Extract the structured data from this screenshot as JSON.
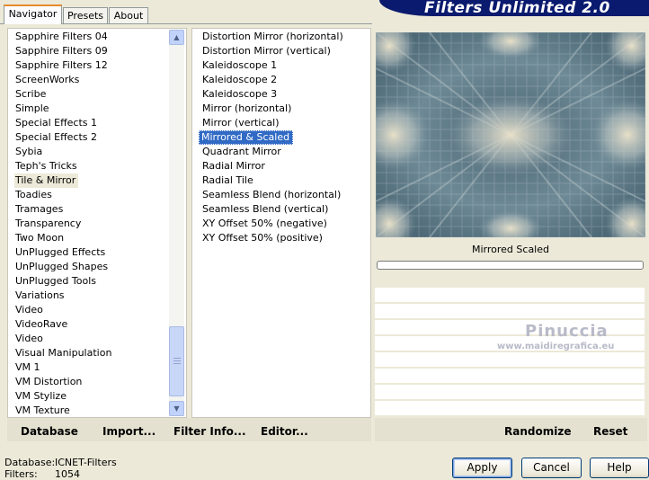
{
  "tabs": [
    "Navigator",
    "Presets",
    "About"
  ],
  "banner_title": "Filters Unlimited 2.0",
  "categories": [
    "Sapphire Filters 04",
    "Sapphire Filters 09",
    "Sapphire Filters 12",
    "ScreenWorks",
    "Scribe",
    "Simple",
    "Special Effects 1",
    "Special Effects 2",
    "Sybia",
    "Teph's Tricks",
    "Tile & Mirror",
    "Toadies",
    "Tramages",
    "Transparency",
    "Two Moon",
    "UnPlugged Effects",
    "UnPlugged Shapes",
    "UnPlugged Tools",
    "Variations",
    "Video",
    "VideoRave",
    "Video",
    "Visual Manipulation",
    "VM 1",
    "VM Distortion",
    "VM Stylize",
    "VM Texture"
  ],
  "selected_category": "Tile & Mirror",
  "filters": [
    "Distortion Mirror (horizontal)",
    "Distortion Mirror (vertical)",
    "Kaleidoscope 1",
    "Kaleidoscope 2",
    "Kaleidoscope 3",
    "Mirror (horizontal)",
    "Mirror (vertical)",
    "Mirrored & Scaled",
    "Quadrant Mirror",
    "Radial Mirror",
    "Radial Tile",
    "Seamless Blend (horizontal)",
    "Seamless Blend (vertical)",
    "XY Offset 50% (negative)",
    "XY Offset 50% (positive)"
  ],
  "selected_filter": "Mirrored & Scaled",
  "preview_label": "Mirrored  Scaled",
  "watermark": {
    "name": "Pinuccia",
    "site": "www.maidiregrafica.eu"
  },
  "toolbar": {
    "database": "Database",
    "import": "Import...",
    "filter_info": "Filter Info...",
    "editor": "Editor...",
    "randomize": "Randomize",
    "reset": "Reset"
  },
  "status": {
    "database_label": "Database:",
    "database_value": "ICNET-Filters",
    "filters_label": "Filters:",
    "filters_value": "1054"
  },
  "buttons": {
    "apply": "Apply",
    "cancel": "Cancel",
    "help": "Help"
  },
  "colors": {
    "selection": "#316ac5",
    "banner": "#0a1a6e",
    "dialog": "#ece9d8"
  }
}
